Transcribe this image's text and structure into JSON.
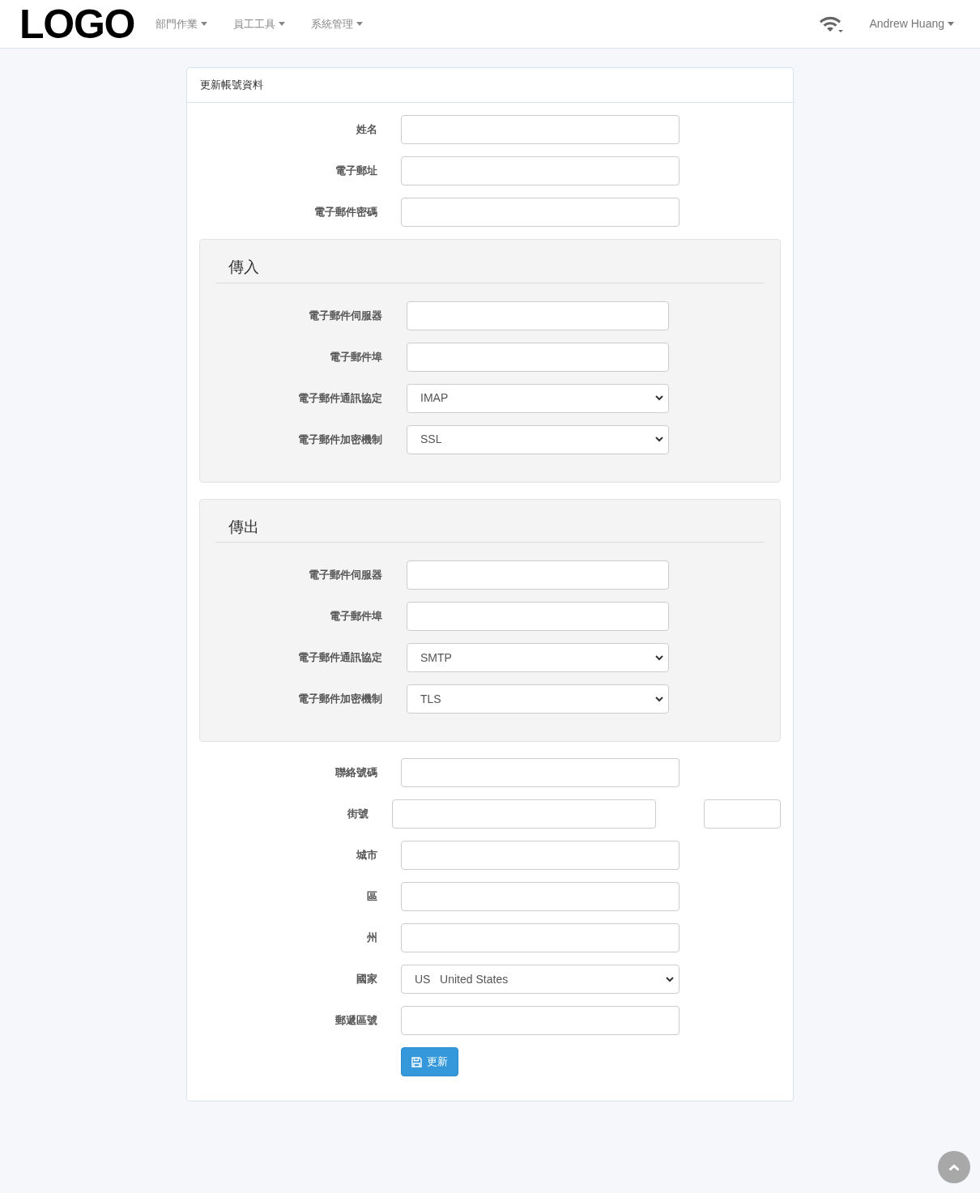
{
  "navbar": {
    "logo": "LOGO",
    "menus": [
      {
        "label": "部門作業"
      },
      {
        "label": "員工工具"
      },
      {
        "label": "系統管理"
      }
    ],
    "user": "Andrew Huang"
  },
  "card": {
    "title": "更新帳號資料",
    "fields": [
      {
        "label": "姓名",
        "kind": "input"
      },
      {
        "label": "電子郵址",
        "kind": "input"
      },
      {
        "label": "電子郵件密碼",
        "kind": "input"
      }
    ],
    "sections": [
      {
        "legend": "傳入",
        "fields": [
          {
            "label": "電子郵件伺服器",
            "kind": "input"
          },
          {
            "label": "電子郵件埠",
            "kind": "input"
          },
          {
            "label": "電子郵件通訊協定",
            "kind": "select",
            "value": "IMAP"
          },
          {
            "label": "電子郵件加密機制",
            "kind": "select",
            "value": "SSL"
          }
        ]
      },
      {
        "legend": "傳出",
        "fields": [
          {
            "label": "電子郵件伺服器",
            "kind": "input"
          },
          {
            "label": "電子郵件埠",
            "kind": "input"
          },
          {
            "label": "電子郵件通訊協定",
            "kind": "select",
            "value": "SMTP"
          },
          {
            "label": "電子郵件加密機制",
            "kind": "select",
            "value": "TLS"
          }
        ]
      }
    ],
    "address_fields": [
      {
        "label": "聯絡號碼",
        "kind": "input"
      },
      {
        "label": "街號",
        "kind": "input_pair"
      },
      {
        "label": "城市",
        "kind": "input"
      },
      {
        "label": "區",
        "kind": "input"
      },
      {
        "label": "州",
        "kind": "input"
      },
      {
        "label": "國家",
        "kind": "country_select",
        "code": "US",
        "value": "United States"
      },
      {
        "label": "郵遞區號",
        "kind": "input"
      }
    ],
    "submit_button": "更新"
  }
}
